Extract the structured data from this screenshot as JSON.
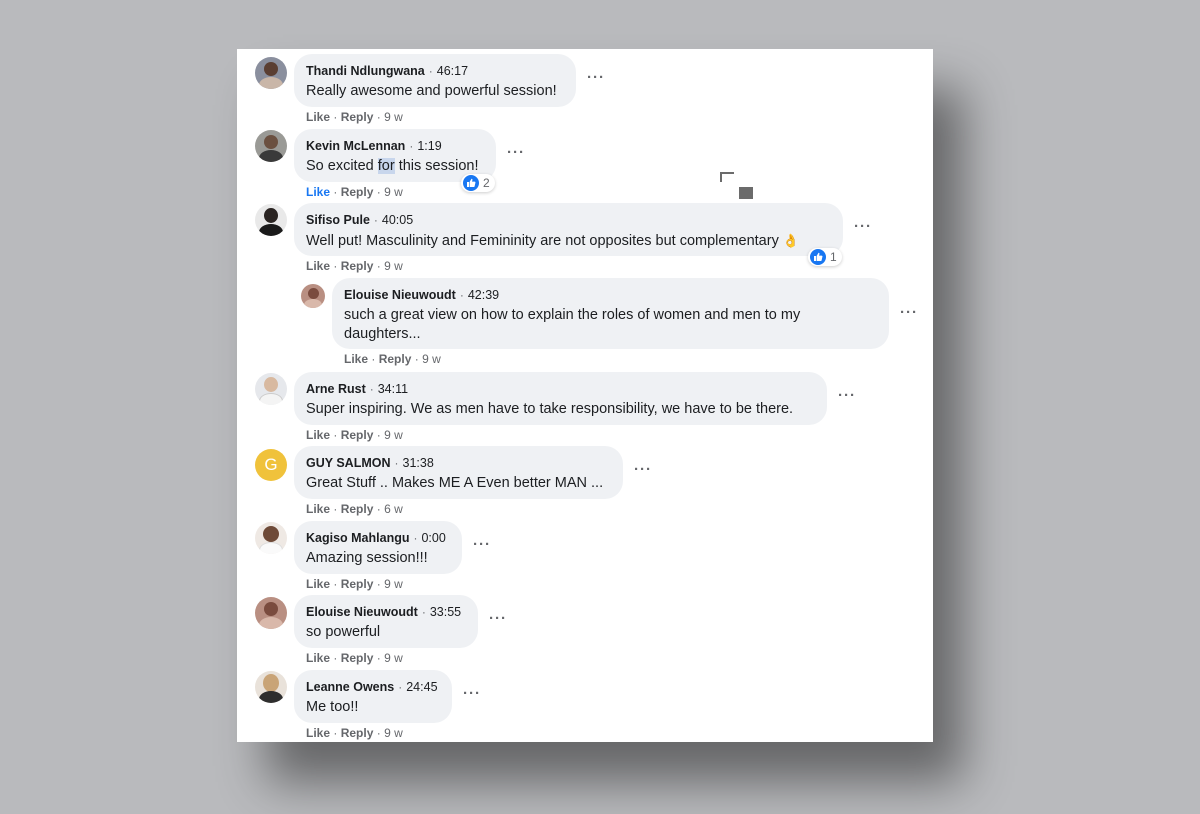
{
  "comments": [
    {
      "author": "Thandi Ndlungwana",
      "time": "46:17",
      "text": "Really awesome and powerful session!",
      "like": "Like",
      "reply": "Reply",
      "age": "9 w"
    },
    {
      "author": "Kevin McLennan",
      "time": "1:19",
      "text_pre": "So excited ",
      "text_hl": "for",
      "text_post": " this session!",
      "like": "Like",
      "reply": "Reply",
      "age": "9 w",
      "reactions": "2"
    },
    {
      "author": "Sifiso Pule",
      "time": "40:05",
      "text": "Well put! Masculinity and Femininity are not opposites but complementary",
      "emoji": "👌",
      "like": "Like",
      "reply": "Reply",
      "age": "9 w",
      "reactions": "1"
    },
    {
      "author": "Elouise Nieuwoudt",
      "time": "42:39",
      "text_line1": "such a great view on how to explain the roles of women and men to my",
      "text_line2": "daughters...",
      "like": "Like",
      "reply": "Reply",
      "age": "9 w"
    },
    {
      "author": "Arne Rust",
      "time": "34:11",
      "text": "Super inspiring. We as men have to take responsibility, we have to be there.",
      "like": "Like",
      "reply": "Reply",
      "age": "9 w"
    },
    {
      "author": "GUY SALMON",
      "time": "31:38",
      "text": "Great Stuff .. Makes ME A Even better MAN ...",
      "like": "Like",
      "reply": "Reply",
      "age": "6 w",
      "initial": "G"
    },
    {
      "author": "Kagiso Mahlangu",
      "time": "0:00",
      "text": "Amazing session!!!",
      "like": "Like",
      "reply": "Reply",
      "age": "9 w"
    },
    {
      "author": "Elouise Nieuwoudt",
      "time": "33:55",
      "text": "so powerful",
      "like": "Like",
      "reply": "Reply",
      "age": "9 w"
    },
    {
      "author": "Leanne Owens",
      "time": "24:45",
      "text": "Me too!!",
      "like": "Like",
      "reply": "Reply",
      "age": "9 w"
    }
  ],
  "separator": "·",
  "more_label": "···",
  "colors": {
    "bubble": "#eff1f4",
    "like_blue": "#1877f2",
    "meta_gray": "#65676b",
    "guy_avatar": "#f0c23b"
  },
  "icons": {
    "more": "more-options-icon",
    "like_reaction": "thumbs-up-icon",
    "avatar": "profile-photo"
  }
}
